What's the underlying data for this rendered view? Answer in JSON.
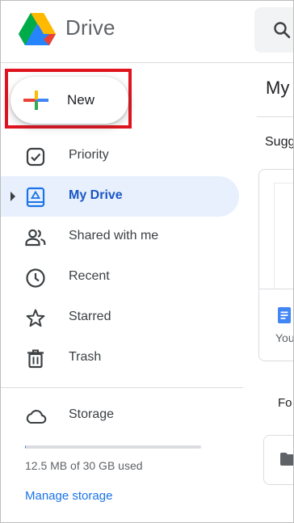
{
  "app": {
    "title": "Drive"
  },
  "new_button": {
    "label": "New"
  },
  "nav": [
    {
      "label": "Priority",
      "icon": "priority-check-icon",
      "active": false
    },
    {
      "label": "My Drive",
      "icon": "my-drive-icon",
      "active": true
    },
    {
      "label": "Shared with me",
      "icon": "shared-people-icon",
      "active": false
    },
    {
      "label": "Recent",
      "icon": "clock-icon",
      "active": false
    },
    {
      "label": "Starred",
      "icon": "star-icon",
      "active": false
    },
    {
      "label": "Trash",
      "icon": "trash-icon",
      "active": false
    }
  ],
  "storage": {
    "label": "Storage",
    "used_text": "12.5 MB of 30 GB used",
    "used_fraction": 0.0004,
    "manage_label": "Manage storage"
  },
  "content": {
    "title": "My",
    "suggested": "Sugg",
    "card_subtitle": "You",
    "folders": "Fo"
  },
  "colors": {
    "accent": "#1a73e8",
    "active_bg": "#e8f0fe",
    "active_text": "#1a56c4",
    "highlight": "#e0141e"
  }
}
